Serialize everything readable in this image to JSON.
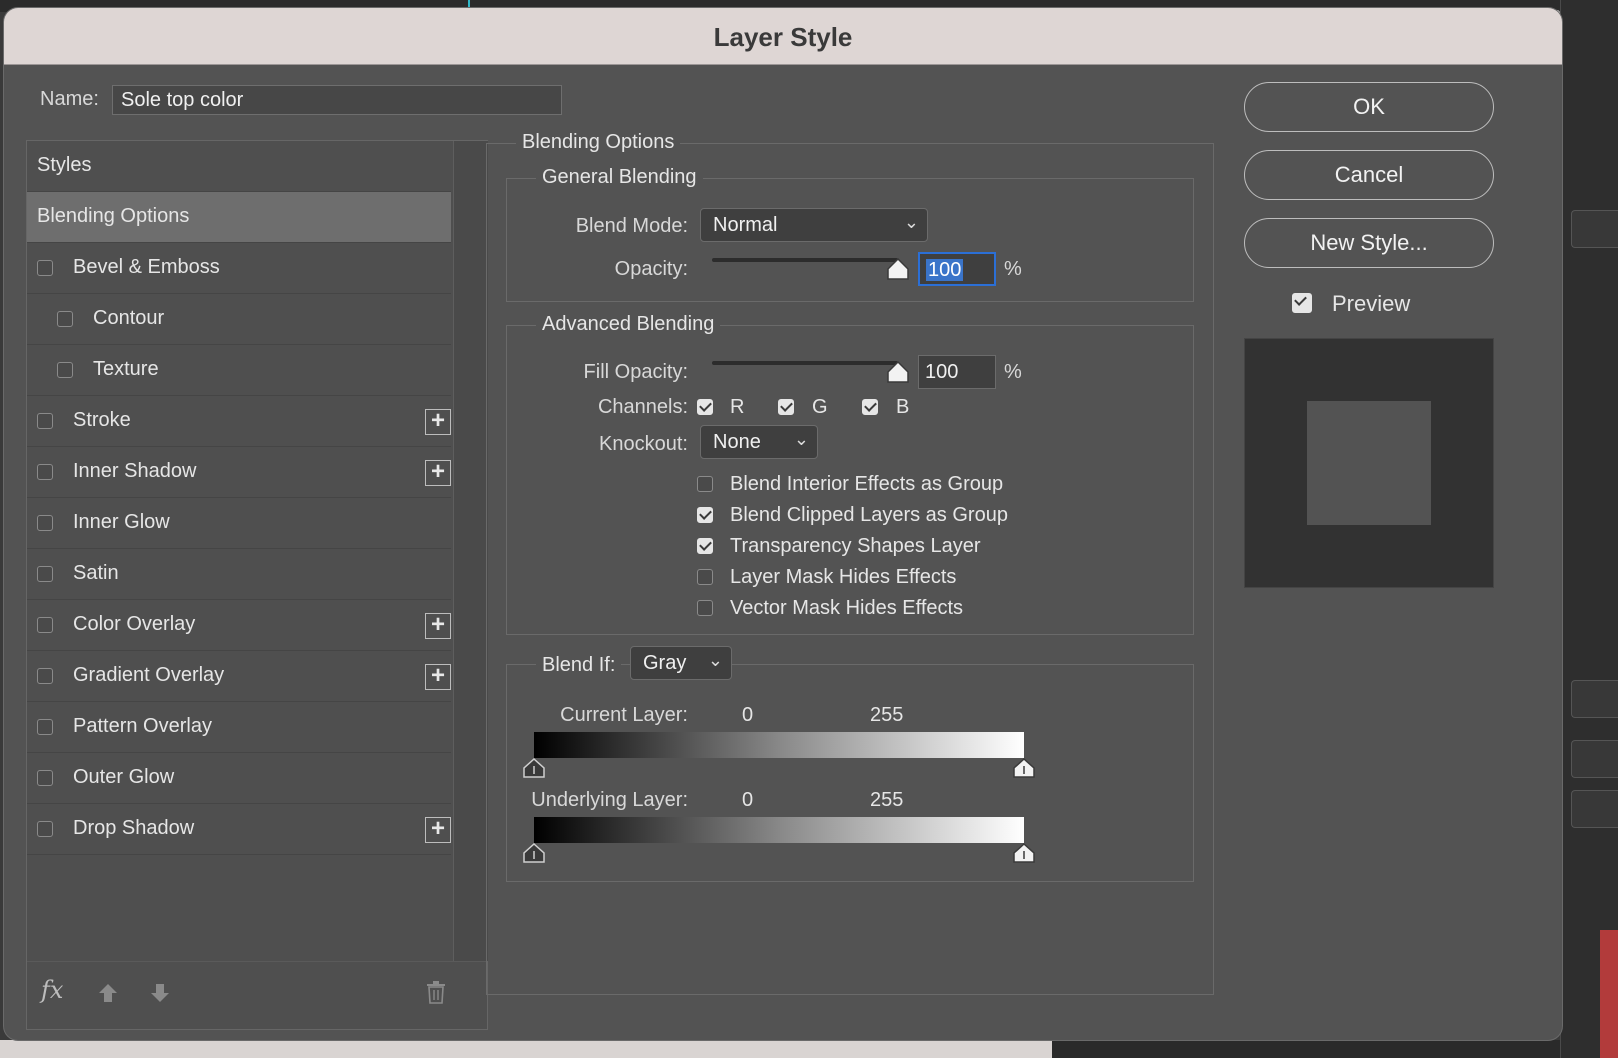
{
  "dialog": {
    "title": "Layer Style"
  },
  "name_field": {
    "label": "Name:",
    "value": "Sole top color"
  },
  "styles_list": {
    "header": "Styles",
    "selected": "Blending Options",
    "items": [
      {
        "label": "Bevel & Emboss",
        "checked": false,
        "add": false
      },
      {
        "label": "Contour",
        "checked": false,
        "add": false,
        "sub": true
      },
      {
        "label": "Texture",
        "checked": false,
        "add": false,
        "sub": true
      },
      {
        "label": "Stroke",
        "checked": false,
        "add": true
      },
      {
        "label": "Inner Shadow",
        "checked": false,
        "add": true
      },
      {
        "label": "Inner Glow",
        "checked": false,
        "add": false
      },
      {
        "label": "Satin",
        "checked": false,
        "add": false
      },
      {
        "label": "Color Overlay",
        "checked": false,
        "add": true
      },
      {
        "label": "Gradient Overlay",
        "checked": false,
        "add": true
      },
      {
        "label": "Pattern Overlay",
        "checked": false,
        "add": false
      },
      {
        "label": "Outer Glow",
        "checked": false,
        "add": false
      },
      {
        "label": "Drop Shadow",
        "checked": false,
        "add": true
      }
    ],
    "footer_icons": [
      "fx-icon",
      "arrow-up-icon",
      "arrow-down-icon",
      "trash-icon"
    ],
    "fx_label": "fx"
  },
  "blending_options": {
    "title": "Blending Options",
    "general": {
      "title": "General Blending",
      "blend_mode_label": "Blend Mode:",
      "blend_mode_value": "Normal",
      "opacity_label": "Opacity:",
      "opacity_value": "100",
      "opacity_unit": "%",
      "opacity_fraction": 1.0
    },
    "advanced": {
      "title": "Advanced Blending",
      "fill_opacity_label": "Fill Opacity:",
      "fill_opacity_value": "100",
      "fill_opacity_unit": "%",
      "fill_opacity_fraction": 1.0,
      "channels_label": "Channels:",
      "channels": [
        {
          "label": "R",
          "checked": true
        },
        {
          "label": "G",
          "checked": true
        },
        {
          "label": "B",
          "checked": true
        }
      ],
      "knockout_label": "Knockout:",
      "knockout_value": "None",
      "options": [
        {
          "label": "Blend Interior Effects as Group",
          "checked": false
        },
        {
          "label": "Blend Clipped Layers as Group",
          "checked": true
        },
        {
          "label": "Transparency Shapes Layer",
          "checked": true
        },
        {
          "label": "Layer Mask Hides Effects",
          "checked": false
        },
        {
          "label": "Vector Mask Hides Effects",
          "checked": false
        }
      ]
    },
    "blend_if": {
      "label": "Blend If:",
      "value": "Gray",
      "current_layer_label": "Current Layer:",
      "current_layer_min": "0",
      "current_layer_max": "255",
      "underlying_layer_label": "Underlying Layer:",
      "underlying_layer_min": "0",
      "underlying_layer_max": "255"
    }
  },
  "buttons": {
    "ok": "OK",
    "cancel": "Cancel",
    "new_style": "New Style..."
  },
  "preview": {
    "label": "Preview",
    "checked": true
  }
}
